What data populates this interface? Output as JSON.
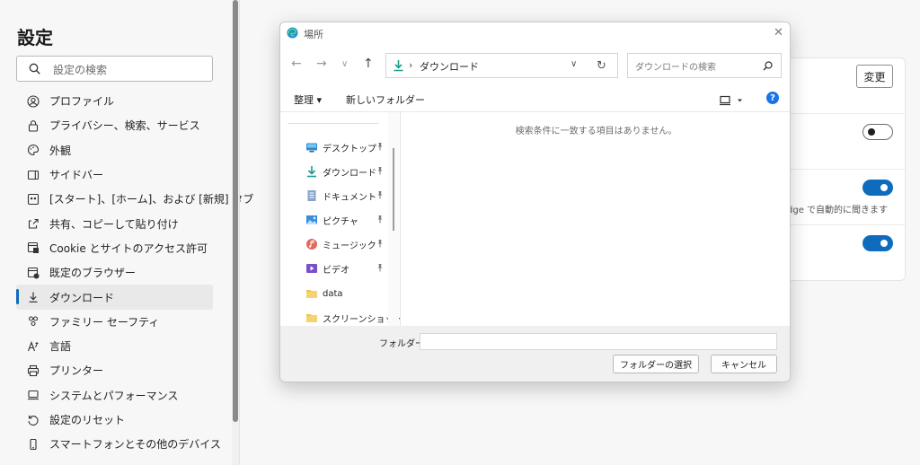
{
  "settings": {
    "title": "設定",
    "search_placeholder": "設定の検索",
    "nav_items": [
      {
        "label": "プロファイル",
        "icon": "profile-icon"
      },
      {
        "label": "プライバシー、検索、サービス",
        "icon": "lock-icon"
      },
      {
        "label": "外観",
        "icon": "appearance-icon"
      },
      {
        "label": "サイドバー",
        "icon": "sidebar-icon"
      },
      {
        "label": "[スタート]、[ホーム]、および [新規] タブ",
        "icon": "home-tab-icon"
      },
      {
        "label": "共有、コピーして貼り付け",
        "icon": "share-icon"
      },
      {
        "label": "Cookie とサイトのアクセス許可",
        "icon": "cookie-icon"
      },
      {
        "label": "既定のブラウザー",
        "icon": "default-browser-icon"
      },
      {
        "label": "ダウンロード",
        "icon": "download-icon",
        "active": true
      },
      {
        "label": "ファミリー セーフティ",
        "icon": "family-icon"
      },
      {
        "label": "言語",
        "icon": "language-icon"
      },
      {
        "label": "プリンター",
        "icon": "printer-icon"
      },
      {
        "label": "システムとパフォーマンス",
        "icon": "system-icon"
      },
      {
        "label": "設定のリセット",
        "icon": "reset-icon"
      },
      {
        "label": "スマートフォンとその他のデバイス",
        "icon": "phone-icon"
      }
    ]
  },
  "background_card": {
    "change_button_label": "変更",
    "partial_text": "dge で自動的に聞きます",
    "toggles": [
      {
        "state": "off"
      },
      {
        "state": "on"
      },
      {
        "state": "on"
      }
    ]
  },
  "dialog": {
    "title": "場所",
    "address_path": "ダウンロード",
    "search_placeholder": "ダウンロードの検索",
    "toolbar": {
      "organize_label": "整理 ▾",
      "new_folder_label": "新しいフォルダー"
    },
    "nav_pane_items": [
      {
        "label": "デスクトップ",
        "icon": "desktop-icon",
        "pinned": true
      },
      {
        "label": "ダウンロード",
        "icon": "download-icon",
        "pinned": true
      },
      {
        "label": "ドキュメント",
        "icon": "document-icon",
        "pinned": true
      },
      {
        "label": "ピクチャ",
        "icon": "pictures-icon",
        "pinned": true
      },
      {
        "label": "ミュージック",
        "icon": "music-icon",
        "pinned": true
      },
      {
        "label": "ビデオ",
        "icon": "video-icon",
        "pinned": true
      },
      {
        "label": "data",
        "icon": "folder-icon",
        "pinned": false
      },
      {
        "label": "スクリーンショット",
        "icon": "folder-icon",
        "pinned": false
      }
    ],
    "empty_message": "検索条件に一致する項目はありません。",
    "folder_label": "フォルダー:",
    "folder_value": "",
    "select_button_label": "フォルダーの選択",
    "cancel_button_label": "キャンセル"
  }
}
